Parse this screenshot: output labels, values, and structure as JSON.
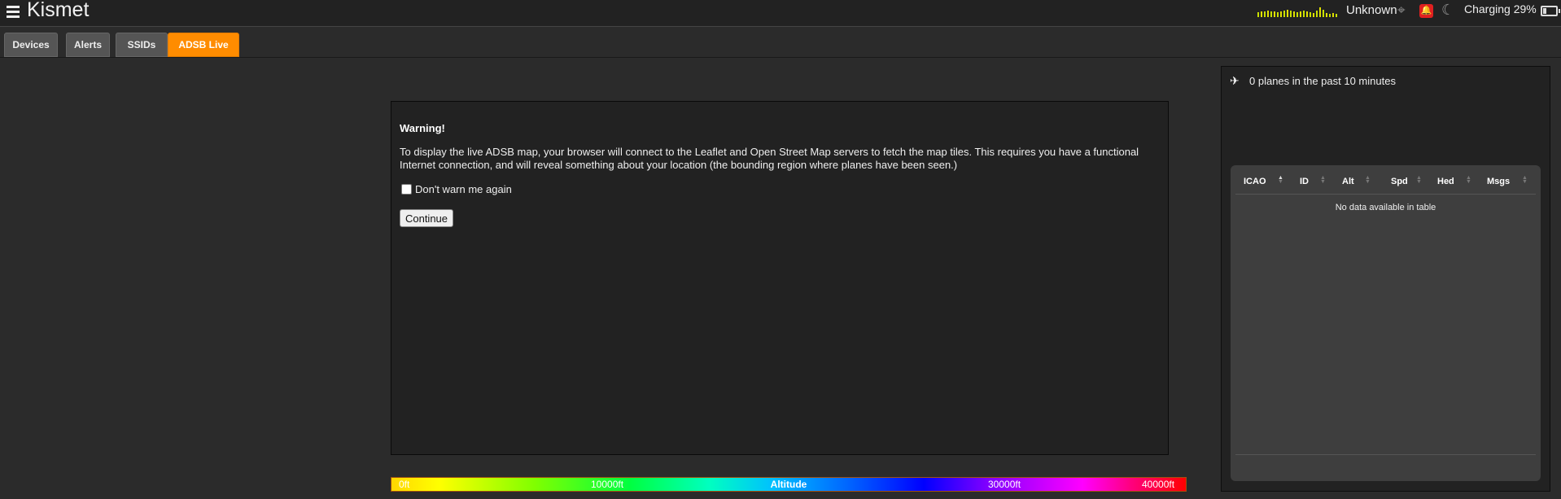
{
  "app": {
    "title": "Kismet"
  },
  "topbar": {
    "gps_status": "Unknown",
    "battery_label": "Charging 29%",
    "battery_level": 0.29,
    "signal_bar_colors": [
      "#c8e000",
      "#e0e000"
    ]
  },
  "tabs": [
    {
      "label": "Devices",
      "active": false
    },
    {
      "label": "Alerts",
      "active": false
    },
    {
      "label": "SSIDs",
      "active": false
    },
    {
      "label": "ADSB Live",
      "active": true
    }
  ],
  "warning": {
    "title": "Warning!",
    "text": "To display the live ADSB map, your browser will connect to the Leaflet and Open Street Map servers to fetch the map tiles. This requires you have a functional Internet connection, and will reveal something about your location (the bounding region where planes have been seen.)",
    "checkbox_label": "Don't warn me again",
    "checkbox_checked": false,
    "continue_label": "Continue"
  },
  "altitude_legend": {
    "title": "Altitude",
    "ticks": [
      "0ft",
      "10000ft",
      "30000ft",
      "40000ft"
    ]
  },
  "planes_panel": {
    "summary": "0 planes in the past 10 minutes",
    "columns": [
      "ICAO",
      "ID",
      "Alt",
      "Spd",
      "Hed",
      "Msgs"
    ],
    "empty_message": "No data available in table"
  },
  "colors": {
    "accent": "#ff8c00",
    "alert": "#e02020",
    "background": "#2b2b2b",
    "panel": "#222222"
  },
  "icons": {
    "menu": "hamburger-icon",
    "gps": "crosshair-icon",
    "alert": "bell-icon",
    "theme": "moon-icon",
    "battery": "battery-icon",
    "plane": "plane-icon"
  }
}
